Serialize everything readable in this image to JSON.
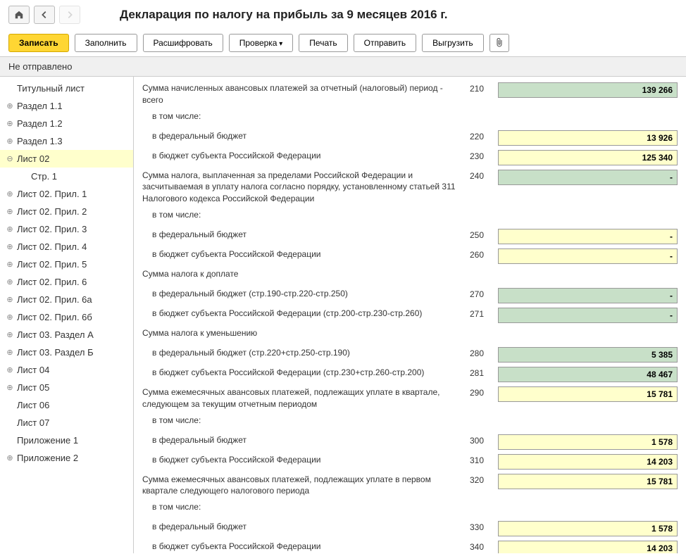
{
  "header": {
    "title": "Декларация по налогу на прибыль за 9 месяцев 2016 г."
  },
  "toolbar": {
    "save": "Записать",
    "fill": "Заполнить",
    "decode": "Расшифровать",
    "check": "Проверка",
    "print": "Печать",
    "send": "Отправить",
    "export": "Выгрузить"
  },
  "status": "Не отправлено",
  "sidebar": [
    {
      "label": "Титульный лист",
      "icon": ""
    },
    {
      "label": "Раздел 1.1",
      "icon": "plus"
    },
    {
      "label": "Раздел 1.2",
      "icon": "plus"
    },
    {
      "label": "Раздел 1.3",
      "icon": "plus"
    },
    {
      "label": "Лист 02",
      "icon": "minus",
      "selected": true
    },
    {
      "label": "Стр. 1",
      "icon": "",
      "indent": true
    },
    {
      "label": "Лист 02. Прил. 1",
      "icon": "plus"
    },
    {
      "label": "Лист 02. Прил. 2",
      "icon": "plus"
    },
    {
      "label": "Лист 02. Прил. 3",
      "icon": "plus"
    },
    {
      "label": "Лист 02. Прил. 4",
      "icon": "plus"
    },
    {
      "label": "Лист 02. Прил. 5",
      "icon": "plus"
    },
    {
      "label": "Лист 02. Прил. 6",
      "icon": "plus"
    },
    {
      "label": "Лист 02. Прил. 6а",
      "icon": "plus"
    },
    {
      "label": "Лист 02. Прил. 6б",
      "icon": "plus"
    },
    {
      "label": "Лист 03. Раздел А",
      "icon": "plus"
    },
    {
      "label": "Лист 03. Раздел Б",
      "icon": "plus"
    },
    {
      "label": "Лист 04",
      "icon": "plus"
    },
    {
      "label": "Лист 05",
      "icon": "plus"
    },
    {
      "label": "Лист 06",
      "icon": ""
    },
    {
      "label": "Лист 07",
      "icon": ""
    },
    {
      "label": "Приложение 1",
      "icon": ""
    },
    {
      "label": "Приложение 2",
      "icon": "plus"
    }
  ],
  "rows": [
    {
      "label": "Сумма начисленных авансовых платежей за отчетный (налоговый) период - всего",
      "code": "210",
      "value": "139 266",
      "color": "green"
    },
    {
      "label": "в том числе:",
      "indent": true,
      "nofield": true
    },
    {
      "label": "в федеральный бюджет",
      "indent": true,
      "code": "220",
      "value": "13 926",
      "color": "yellow"
    },
    {
      "label": "в бюджет субъекта Российской Федерации",
      "indent": true,
      "code": "230",
      "value": "125 340",
      "color": "yellow"
    },
    {
      "label": "Сумма налога, выплаченная за пределами Российской Федерации и засчитываемая в уплату налога согласно порядку, установленному статьей 311 Налогового кодекса Российской Федерации",
      "code": "240",
      "value": "-",
      "color": "green"
    },
    {
      "label": "в том числе:",
      "indent": true,
      "nofield": true
    },
    {
      "label": "в федеральный бюджет",
      "indent": true,
      "code": "250",
      "value": "-",
      "color": "yellow"
    },
    {
      "label": "в бюджет субъекта Российской Федерации",
      "indent": true,
      "code": "260",
      "value": "-",
      "color": "yellow"
    },
    {
      "label": "Сумма налога к доплате",
      "nofield": true
    },
    {
      "label": "в федеральный бюджет (стр.190-стр.220-стр.250)",
      "indent": true,
      "code": "270",
      "value": "-",
      "color": "green"
    },
    {
      "label": "в бюджет субъекта Российской Федерации (стр.200-стр.230-стр.260)",
      "indent": true,
      "code": "271",
      "value": "-",
      "color": "green"
    },
    {
      "label": "Сумма налога к уменьшению",
      "nofield": true
    },
    {
      "label": "в федеральный бюджет (стр.220+стр.250-стр.190)",
      "indent": true,
      "code": "280",
      "value": "5 385",
      "color": "green"
    },
    {
      "label": "в бюджет субъекта Российской Федерации (стр.230+стр.260-стр.200)",
      "indent": true,
      "code": "281",
      "value": "48 467",
      "color": "green"
    },
    {
      "label": "Сумма ежемесячных авансовых платежей, подлежащих уплате в квартале, следующем за текущим отчетным периодом",
      "code": "290",
      "value": "15 781",
      "color": "yellow"
    },
    {
      "label": "в том числе:",
      "indent": true,
      "nofield": true
    },
    {
      "label": "в федеральный бюджет",
      "indent": true,
      "code": "300",
      "value": "1 578",
      "color": "yellow"
    },
    {
      "label": "в бюджет субъекта Российской Федерации",
      "indent": true,
      "code": "310",
      "value": "14 203",
      "color": "yellow"
    },
    {
      "label": "Сумма ежемесячных авансовых платежей, подлежащих уплате в первом квартале следующего налогового периода",
      "code": "320",
      "value": "15 781",
      "color": "yellow"
    },
    {
      "label": "в том числе:",
      "indent": true,
      "nofield": true
    },
    {
      "label": "в федеральный бюджет",
      "indent": true,
      "code": "330",
      "value": "1 578",
      "color": "yellow"
    },
    {
      "label": "в бюджет субъекта Российской Федерации",
      "indent": true,
      "code": "340",
      "value": "14 203",
      "color": "yellow"
    }
  ]
}
